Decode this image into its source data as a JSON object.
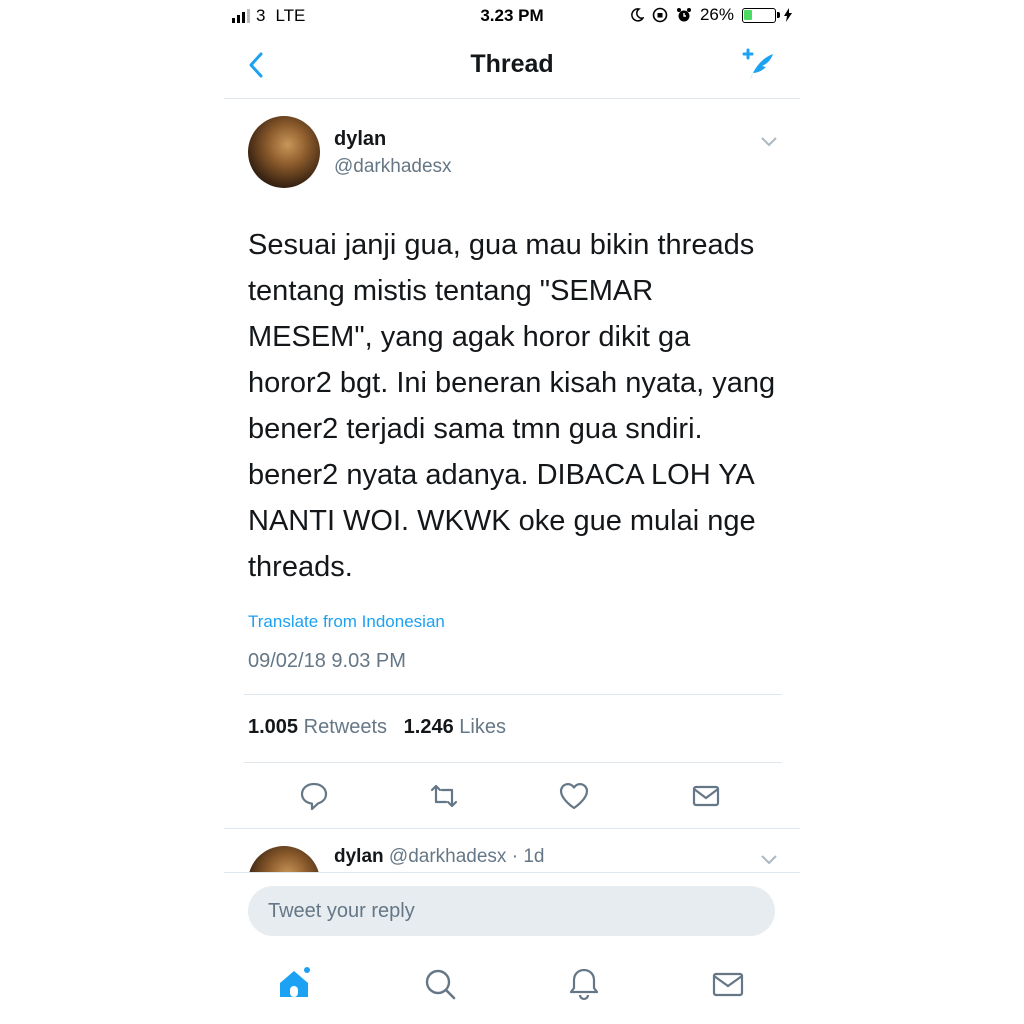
{
  "status_bar": {
    "carrier": "3",
    "network": "LTE",
    "time": "3.23 PM",
    "battery": "26%",
    "battery_level": 0.26
  },
  "nav": {
    "title": "Thread",
    "back_icon": "chevron-left-icon",
    "compose_icon": "compose-tweet-icon"
  },
  "tweet": {
    "name": "dylan",
    "handle": "@darkhadesx",
    "lines": [
      "Sesuai janji gua, gua mau bikin threads",
      "tentang mistis tentang \"SEMAR",
      "MESEM\",  yang agak horor dikit ga",
      "horor2 bgt. Ini beneran kisah nyata, yang",
      "bener2 terjadi sama tmn gua sndiri.",
      "bener2 nyata adanya. DIBACA LOH YA",
      "NANTI WOI. WKWK oke gue mulai nge",
      "threads."
    ],
    "translate": "Translate from Indonesian",
    "timestamp": "09/02/18 9.03 PM",
    "retweets_count": "1.005",
    "retweets_label": "Retweets",
    "likes_count": "1.246",
    "likes_label": "Likes"
  },
  "reply_preview": {
    "name": "dylan",
    "handle": "@darkhadesx",
    "age": "· 1d"
  },
  "composer": {
    "placeholder": "Tweet your reply"
  },
  "colors": {
    "accent": "#1da1f2",
    "secondary_text": "#657786",
    "divider": "#e1e8ed"
  }
}
